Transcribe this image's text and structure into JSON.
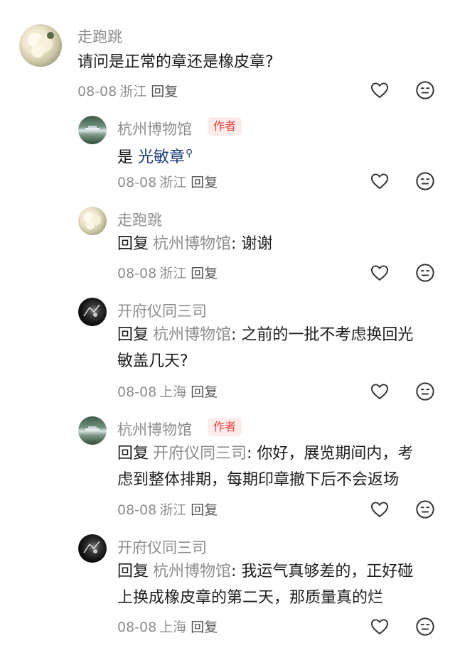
{
  "comments": [
    {
      "name": "走跑跳",
      "content": "请问是正常的章还是橡皮章?",
      "date": "08-08",
      "location": "浙江",
      "reply_label": "回复"
    }
  ],
  "replies": [
    {
      "name": "杭州博物馆",
      "badge": "作者",
      "content_prefix": "是",
      "link_text": "光敏章",
      "date": "08-08",
      "location": "浙江",
      "reply_label": "回复"
    },
    {
      "name": "走跑跳",
      "reply_word": "回复",
      "reply_target": "杭州博物馆",
      "content": ": 谢谢",
      "date": "08-08",
      "location": "浙江",
      "reply_label": "回复"
    },
    {
      "name": "开府仪同三司",
      "reply_word": "回复",
      "reply_target": "杭州博物馆",
      "content_line1": ": 之前的一批不考虑换回光",
      "content_line2": "敏盖几天?",
      "date": "08-08",
      "location": "上海",
      "reply_label": "回复"
    },
    {
      "name": "杭州博物馆",
      "badge": "作者",
      "reply_word": "回复",
      "reply_target": "开府仪同三司",
      "content_line1": ": 你好，展览期间内，考",
      "content_line2": "虑到整体排期，每期印章撤下后不会返场",
      "date": "08-08",
      "location": "浙江",
      "reply_label": "回复"
    },
    {
      "name": "开府仪同三司",
      "reply_word": "回复",
      "reply_target": "杭州博物馆",
      "content_line1": ": 我运气真够差的，正好碰",
      "content_line2": "上换成橡皮章的第二天，那质量真的烂",
      "date": "08-08",
      "location": "上海",
      "reply_label": "回复"
    }
  ],
  "icons": {
    "like": "heart-outline-icon",
    "dislike": "neutral-face-icon",
    "link": "search-magnifier-icon"
  },
  "colors": {
    "author_badge_text": "#e8413c",
    "author_badge_bg": "#fdecea",
    "link": "#1b3d7a",
    "muted": "#8e8e8e"
  }
}
